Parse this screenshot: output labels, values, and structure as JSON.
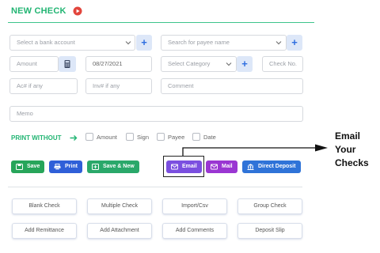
{
  "header": {
    "title": "NEW CHECK",
    "play_icon": "play-circle-icon",
    "accent": "#22b573"
  },
  "form": {
    "bank_account": {
      "placeholder": "Select a bank account"
    },
    "payee": {
      "placeholder": "Search for payee name"
    },
    "amount": {
      "placeholder": "Amount"
    },
    "date": {
      "value": "08/27/2021"
    },
    "category": {
      "placeholder": "Select Category"
    },
    "check_no": {
      "placeholder": "Check No."
    },
    "account_no": {
      "placeholder": "Ac# if any"
    },
    "invoice_no": {
      "placeholder": "Inv# if any"
    },
    "comment": {
      "placeholder": "Comment"
    },
    "memo": {
      "placeholder": "Memo"
    }
  },
  "print_without": {
    "label": "PRINT WITHOUT",
    "options": [
      "Amount",
      "Sign",
      "Payee",
      "Date"
    ]
  },
  "actions": [
    {
      "label": "Save",
      "icon": "save-icon",
      "color": "#27a55a"
    },
    {
      "label": "Print",
      "icon": "printer-icon",
      "color": "#2f5fd8"
    },
    {
      "label": "Save & New",
      "icon": "plus-square-icon",
      "color": "#2aa86a"
    },
    {
      "label": "Email",
      "icon": "envelope-icon",
      "color": "#7b4fe0"
    },
    {
      "label": "Mail",
      "icon": "envelope-icon",
      "color": "#9a36d2"
    },
    {
      "label": "Direct Deposit",
      "icon": "bank-icon",
      "color": "#2f73d8"
    }
  ],
  "grid_buttons": [
    [
      "Blank Check",
      "Multiple Check",
      "Import/Csv",
      "Group Check"
    ],
    [
      "Add Remittance",
      "Add Attachment",
      "Add Comments",
      "Deposit Slip"
    ]
  ],
  "callout": {
    "lines": [
      "Email",
      "Your",
      "Checks"
    ]
  }
}
